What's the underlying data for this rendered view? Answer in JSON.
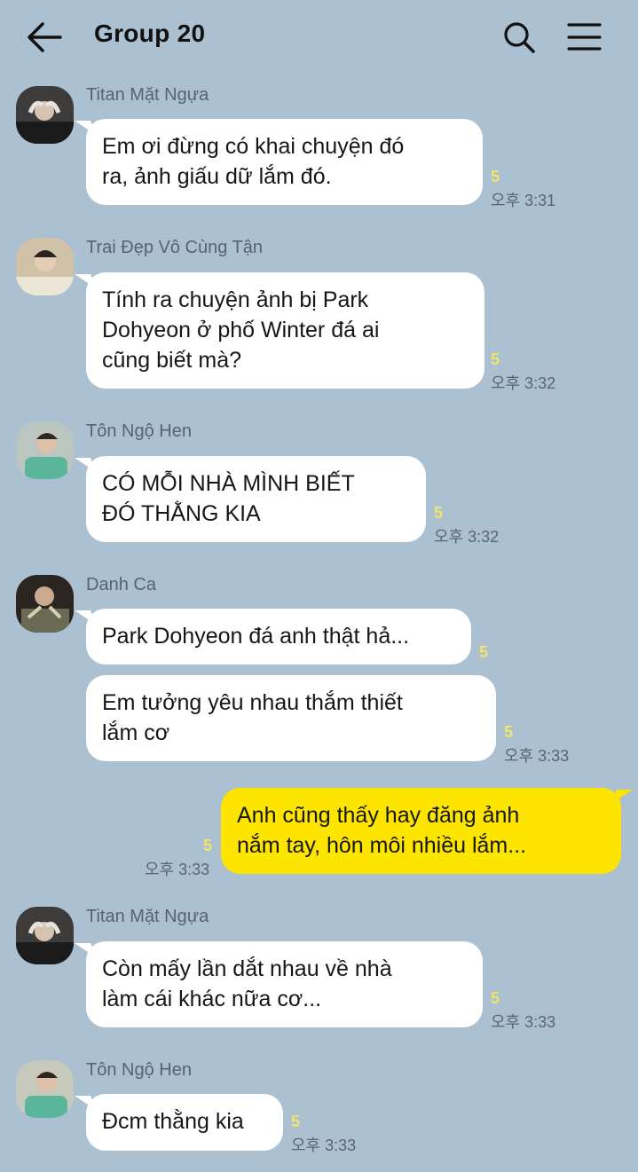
{
  "header": {
    "back_icon": "arrow-left-icon",
    "title": "Group 20",
    "search_icon": "search-icon",
    "menu_icon": "hamburger-menu-icon"
  },
  "colors": {
    "background": "#abc1d1",
    "incoming_bubble": "#ffffff",
    "outgoing_bubble": "#fee500",
    "unread_count": "#f3e36a"
  },
  "messages": [
    {
      "sender": "Titan Mặt Ngựa",
      "text": "Em ơi đừng có khai chuyện đó\nra, ảnh giấu dữ lắm đó.",
      "unread": "5",
      "time": "오후 3:31"
    },
    {
      "sender": "Trai Đẹp Vô Cùng Tận",
      "text": "Tính ra chuyện ảnh bị Park\nDohyeon ở phố Winter đá ai\ncũng biết mà?",
      "unread": "5",
      "time": "오후 3:32"
    },
    {
      "sender": "Tôn Ngộ Hen",
      "text": "CÓ MỖI NHÀ MÌNH BIẾT\nĐÓ THẰNG KIA",
      "unread": "5",
      "time": "오후 3:32"
    },
    {
      "sender": "Danh Ca",
      "text": "Park Dohyeon đá anh thật hả...",
      "unread": "5",
      "time": ""
    },
    {
      "sender": "",
      "text": "Em tưởng yêu nhau thắm thiết\nlắm cơ",
      "unread": "5",
      "time": "오후 3:33"
    },
    {
      "sender": "",
      "text": "Anh cũng thấy hay đăng ảnh\nnắm tay, hôn môi nhiều lắm...",
      "unread": "5",
      "time": "오후 3:33"
    },
    {
      "sender": "Titan Mặt Ngựa",
      "text": "Còn mấy lần dắt nhau về nhà\nlàm cái khác nữa cơ...",
      "unread": "5",
      "time": "오후 3:33"
    },
    {
      "sender": "Tôn Ngộ Hen",
      "text": "Đcm thằng kia",
      "unread": "5",
      "time": "오후 3:33"
    }
  ]
}
